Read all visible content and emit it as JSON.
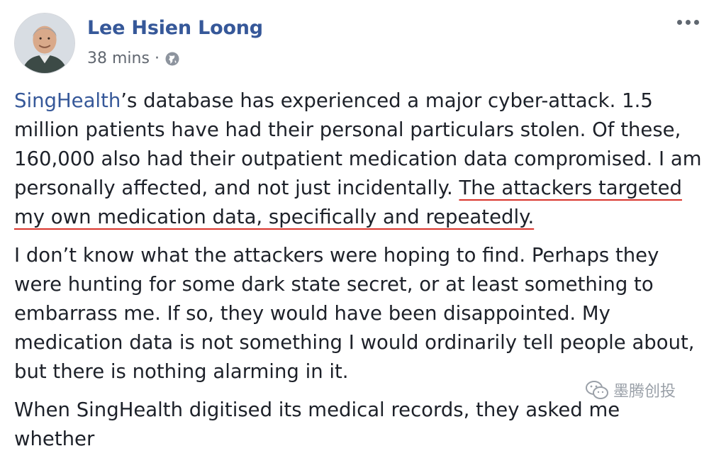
{
  "post": {
    "author": "Lee Hsien Loong",
    "timestamp": "38 mins",
    "separator": "·",
    "privacy_icon": "globe-icon",
    "menu_icon": "more-options-icon"
  },
  "paragraphs": {
    "p1": {
      "tag": "SingHealth",
      "text1": "’s database has experienced a major cyber-attack. 1.5 million patients have had their personal particulars stolen. Of these, 160,000 also had their outpatient medication data compromised. I am personally affected, and not just incidentally. ",
      "highlighted": "The attackers targeted my own medication data, specifically and repeatedly."
    },
    "p2": "I don’t know what the attackers were hoping to find. Perhaps they were hunting for some dark state secret, or at least something to embarrass me. If so, they would have been disappointed. My medication data is not something I would ordinarily tell people about, but there is nothing alarming in it.",
    "p3": "When SingHealth digitised its medical records, they asked me whether"
  },
  "watermark": {
    "text": "墨腾创投",
    "icon": "wechat-icon"
  },
  "colors": {
    "author_link": "#365899",
    "text": "#1d2129",
    "meta": "#616770",
    "underline": "#d9342b"
  }
}
